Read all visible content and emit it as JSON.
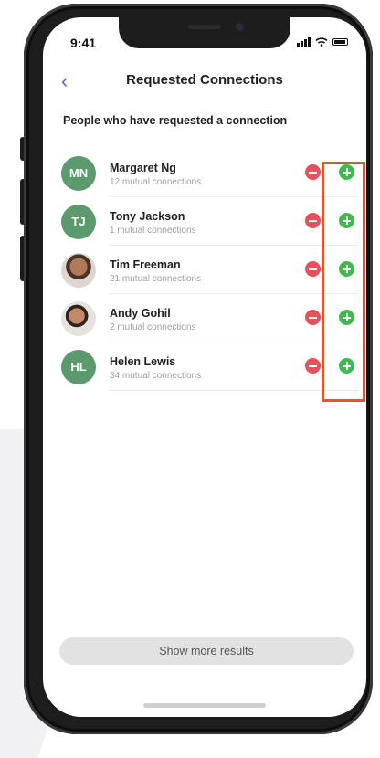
{
  "status": {
    "time": "9:41"
  },
  "nav": {
    "back_icon": "chevron-left-icon",
    "title": "Requested Connections"
  },
  "section": {
    "title": "People who have requested a connection"
  },
  "requests": [
    {
      "initials": "MN",
      "name": "Margaret Ng",
      "mutual": "12 mutual connections",
      "avatar": "initials"
    },
    {
      "initials": "TJ",
      "name": "Tony Jackson",
      "mutual": "1 mutual connections",
      "avatar": "initials"
    },
    {
      "initials": "",
      "name": "Tim Freeman",
      "mutual": "21 mutual connections",
      "avatar": "photo"
    },
    {
      "initials": "",
      "name": "Andy Gohil",
      "mutual": "2 mutual connections",
      "avatar": "photo"
    },
    {
      "initials": "HL",
      "name": "Helen Lewis",
      "mutual": "34 mutual connections",
      "avatar": "initials"
    }
  ],
  "actions": {
    "decline_icon": "minus-circle-icon",
    "accept_icon": "plus-circle-icon"
  },
  "footer": {
    "more_label": "Show more results"
  },
  "colors": {
    "accent": "#7b4fc9",
    "accept": "#3dbb4c",
    "decline": "#e8505b",
    "avatar": "#5a9a6c",
    "highlight": "#e8542a"
  }
}
